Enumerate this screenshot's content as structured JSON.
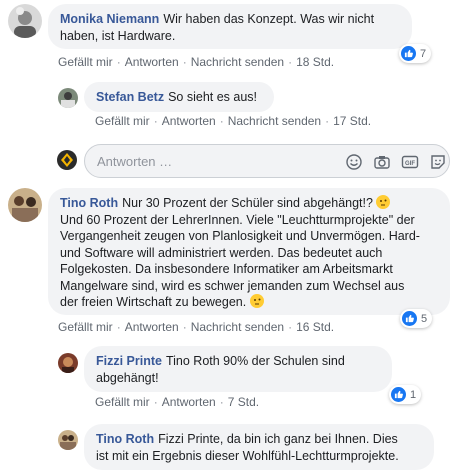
{
  "comments": [
    {
      "author": "Monika Niemann",
      "text_line1": "Wir haben das Konzept. Was wir nicht",
      "text_line2": "haben, ist Hardware.",
      "like": "Gefällt mir",
      "reply": "Antworten",
      "message": "Nachricht senden",
      "time": "18 Std.",
      "reactions": "7"
    },
    {
      "author": "Stefan Betz",
      "text_line1": "So sieht es aus!",
      "like": "Gefällt mir",
      "reply": "Antworten",
      "message": "Nachricht senden",
      "time": "17 Std."
    },
    {
      "author": "Tino Roth",
      "text_line1": "Nur 30 Prozent der Schüler sind abgehängt!?",
      "text_line2": "Und 60 Prozent der LehrerInnen. Viele \"Leuchtturmprojekte\" der",
      "text_line3": "Vergangenheit zeugen von Planlosigkeit und Unvermögen. Hard-",
      "text_line4": "und Software will administriert werden. Das bedeutet auch",
      "text_line5": "Folgekosten. Da insbesondere Informatiker am Arbeitsmarkt",
      "text_line6": "Mangelware sind, wird es schwer jemanden zum Wechsel aus",
      "text_line7": "der freien Wirtschaft zu bewegen.",
      "like": "Gefällt mir",
      "reply": "Antworten",
      "message": "Nachricht senden",
      "time": "16 Std.",
      "reactions": "5"
    },
    {
      "author": "Fizzi Printe",
      "text_line1": "Tino Roth 90% der Schulen sind",
      "text_line2": "abgehängt!",
      "like": "Gefällt mir",
      "reply": "Antworten",
      "time": "7 Std.",
      "reactions": "1"
    },
    {
      "author": "Tino Roth",
      "text_line1": "Fizzi Printe, da bin ich ganz bei Ihnen. Dies",
      "text_line2": "ist mit ein Ergebnis dieser Wohlfühl-Lechtturmprojekte."
    }
  ],
  "reply_box": {
    "placeholder": "Antworten …",
    "icons": [
      "emoji-icon",
      "camera-icon",
      "gif-icon",
      "sticker-icon"
    ]
  },
  "colors": {
    "author": "#385898",
    "bubble": "#f2f3f5",
    "like": "#1877f2"
  }
}
